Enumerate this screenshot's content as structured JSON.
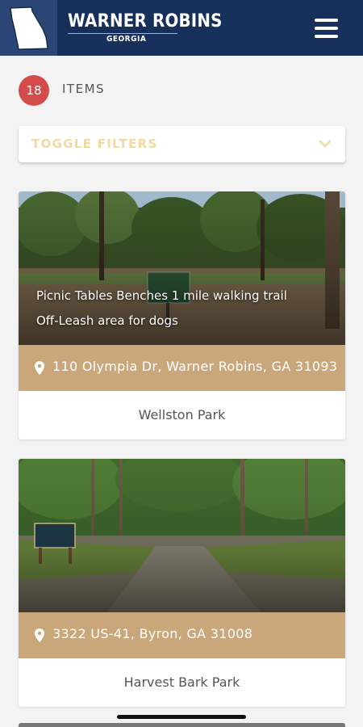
{
  "header": {
    "brand_title": "WARNER ROBINS",
    "brand_subtitle": "GEORGIA",
    "logo_icon": "georgia-state-outline-icon",
    "menu_icon": "hamburger-menu-icon"
  },
  "results": {
    "count": "18",
    "label": "ITEMS"
  },
  "filters": {
    "toggle_label": "TOGGLE FILTERS",
    "chevron_icon": "chevron-down-icon"
  },
  "parks": [
    {
      "description": "Picnic Tables Benches 1 mile walking trail Off-Leash area for dogs",
      "address": "110 Olympia Dr, Warner Robins, GA 31093",
      "name": "Wellston Park"
    },
    {
      "description": "",
      "address": "3322 US-41, Byron, GA 31008",
      "name": "Harvest Bark Park"
    }
  ],
  "colors": {
    "header_bg": "#16305b",
    "logo_bg": "#2b4674",
    "badge": "#d34b4b",
    "address_bar": "#c9a77a",
    "filter_text": "#f1d9a1"
  }
}
